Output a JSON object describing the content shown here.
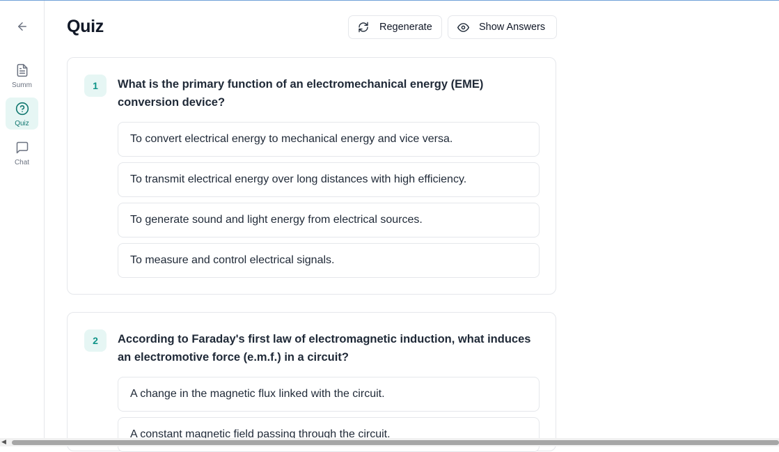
{
  "sidebar": {
    "back_icon": "arrow-left-icon",
    "items": [
      {
        "label": "Summ",
        "icon": "document-icon",
        "active": false
      },
      {
        "label": "Quiz",
        "icon": "question-circle-icon",
        "active": true
      },
      {
        "label": "Chat",
        "icon": "chat-bubble-icon",
        "active": false
      }
    ]
  },
  "header": {
    "title": "Quiz",
    "regenerate_label": "Regenerate",
    "show_answers_label": "Show Answers"
  },
  "questions": [
    {
      "number": "1",
      "text": "What is the primary function of an electromechanical energy (EME) conversion device?",
      "options": [
        "To convert electrical energy to mechanical energy and vice versa.",
        "To transmit electrical energy over long distances with high efficiency.",
        "To generate sound and light energy from electrical sources.",
        "To measure and control electrical signals."
      ]
    },
    {
      "number": "2",
      "text": "According to Faraday's first law of electromagnetic induction, what induces an electromotive force (e.m.f.) in a circuit?",
      "options": [
        "A change in the magnetic flux linked with the circuit.",
        "A constant magnetic field passing through the circuit."
      ]
    }
  ],
  "colors": {
    "accent": "#0f9488",
    "accent_bg": "#e6f6f4",
    "border": "#e5e7eb"
  }
}
